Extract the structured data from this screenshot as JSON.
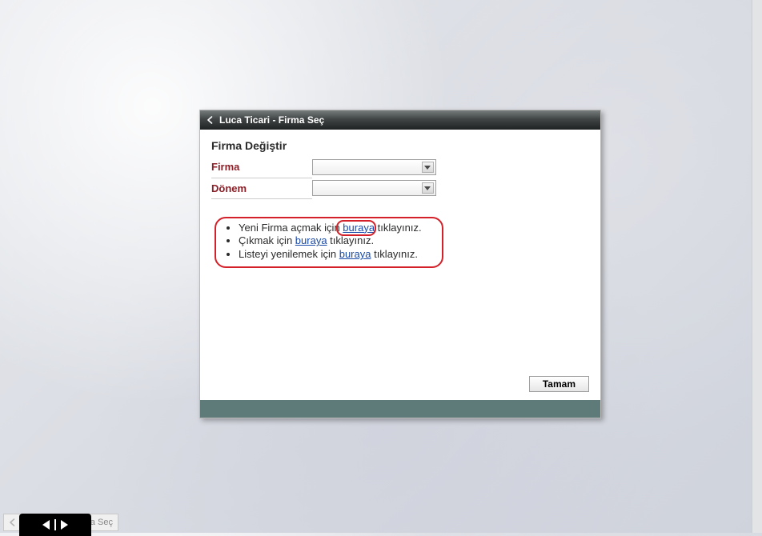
{
  "dialog": {
    "title": "Luca Ticari - Firma Seç",
    "heading": "Firma Değiştir",
    "firma_label": "Firma",
    "donem_label": "Dönem"
  },
  "callout": {
    "items": [
      {
        "prefix": "Yeni Firma açmak için ",
        "link": "buraya",
        "suffix": " tıklayınız."
      },
      {
        "prefix": "Çıkmak için ",
        "link": "buraya",
        "suffix": " tıklayınız."
      },
      {
        "prefix": "Listeyi yenilemek için ",
        "link": "buraya",
        "suffix": " tıklayınız."
      }
    ]
  },
  "button": {
    "ok": "Tamam"
  },
  "stub": {
    "label": "a Seç"
  }
}
